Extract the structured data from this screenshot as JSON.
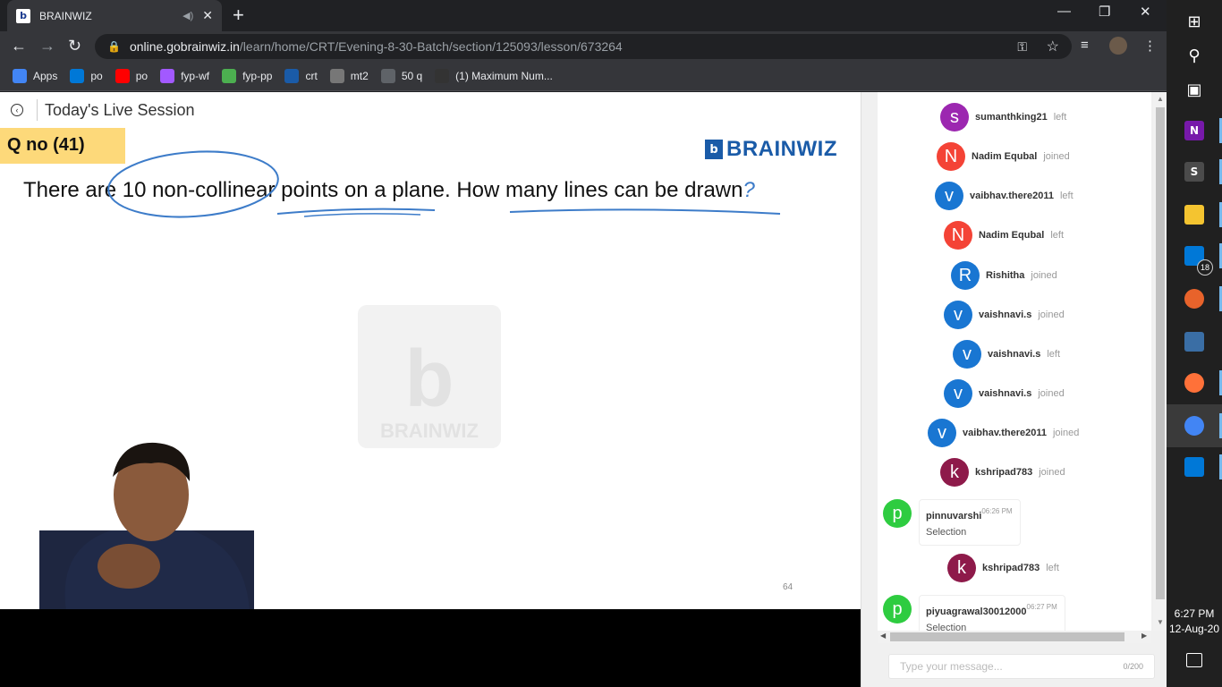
{
  "browser": {
    "tab_title": "BRAINWIZ",
    "tab_favicon": "b",
    "url_host": "online.gobrainwiz.in",
    "url_path": "/learn/home/CRT/Evening-8-30-Batch/section/125093/lesson/673264",
    "bookmarks": [
      {
        "label": "Apps",
        "icon": "apps-grid-icon",
        "color": "#4285f4"
      },
      {
        "label": "po",
        "icon": "edge-icon",
        "color": "#0078d7"
      },
      {
        "label": "po",
        "icon": "youtube-icon",
        "color": "#ff0000"
      },
      {
        "label": "fyp-wf",
        "icon": "figma-icon",
        "color": "#a259ff"
      },
      {
        "label": "fyp-pp",
        "icon": "pp-icon",
        "color": "#4caf50"
      },
      {
        "label": "crt",
        "icon": "brainwiz-icon",
        "color": "#1a5ba8"
      },
      {
        "label": "mt2",
        "icon": "cc-icon",
        "color": "#777777"
      },
      {
        "label": "50 q",
        "icon": "globe-icon",
        "color": "#5f6368"
      },
      {
        "label": "(1) Maximum Num...",
        "icon": "hackerrank-icon",
        "color": "#333333"
      }
    ]
  },
  "page": {
    "title": "Today's Live Session"
  },
  "slide": {
    "qno": "Q no (41)",
    "brand": "BRAINWIZ",
    "brand_mark": "b",
    "question": "There are 10 non-collinear points on a plane. How many lines can be drawn",
    "question_mark": "?",
    "watermark_text": "BRAINWIZ",
    "page_number": "64"
  },
  "chat": {
    "events": [
      {
        "initial": "s",
        "user": "sumanthking21",
        "status": "left",
        "color": "#9c27b0"
      },
      {
        "initial": "N",
        "user": "Nadim Equbal",
        "status": "joined",
        "color": "#f44336"
      },
      {
        "initial": "v",
        "user": "vaibhav.there2011",
        "status": "left",
        "color": "#1976d2"
      },
      {
        "initial": "N",
        "user": "Nadim Equbal",
        "status": "left",
        "color": "#f44336"
      },
      {
        "initial": "R",
        "user": "Rishitha",
        "status": "joined",
        "color": "#1976d2"
      },
      {
        "initial": "v",
        "user": "vaishnavi.s",
        "status": "joined",
        "color": "#1976d2"
      },
      {
        "initial": "v",
        "user": "vaishnavi.s",
        "status": "left",
        "color": "#1976d2"
      },
      {
        "initial": "v",
        "user": "vaishnavi.s",
        "status": "joined",
        "color": "#1976d2"
      },
      {
        "initial": "v",
        "user": "vaibhav.there2011",
        "status": "joined",
        "color": "#1976d2"
      },
      {
        "initial": "k",
        "user": "kshripad783",
        "status": "joined",
        "color": "#8e1a4a"
      },
      {
        "initial": "k",
        "user": "kshripad783",
        "status": "left",
        "color": "#8e1a4a"
      }
    ],
    "messages": [
      {
        "initial": "p",
        "user": "pinnuvarshi",
        "time": "06:26 PM",
        "text": "Selection",
        "color": "#2ecc40"
      },
      {
        "initial": "p",
        "user": "piyuagrawal30012000",
        "time": "06:27 PM",
        "text": "Selection",
        "color": "#2ecc40"
      }
    ],
    "input_placeholder": "Type your message...",
    "char_counter": "0/200"
  },
  "taskbar": {
    "apps": [
      {
        "name": "windows-start-icon",
        "label": "",
        "color": "#ffffff"
      },
      {
        "name": "search-icon",
        "label": "",
        "color": "#ffffff"
      },
      {
        "name": "task-view-icon",
        "label": "",
        "color": "#ffffff"
      },
      {
        "name": "onenote-icon",
        "label": "N",
        "color": "#7719aa"
      },
      {
        "name": "sublime-text-icon",
        "label": "S",
        "color": "#4b4b4b"
      },
      {
        "name": "file-explorer-icon",
        "label": "",
        "color": "#f4c430"
      },
      {
        "name": "phone-icon",
        "label": "",
        "color": "#0078d7"
      },
      {
        "name": "media-player-icon",
        "label": "",
        "color": "#e8632b"
      },
      {
        "name": "calculator-icon",
        "label": "",
        "color": "#3a6ea5"
      },
      {
        "name": "firefox-icon",
        "label": "",
        "color": "#ff7139"
      },
      {
        "name": "chrome-icon",
        "label": "",
        "color": "#4285f4"
      },
      {
        "name": "photos-icon",
        "label": "",
        "color": "#0078d7"
      }
    ],
    "badge_count": "18",
    "time": "6:27 PM",
    "date": "12-Aug-20"
  }
}
